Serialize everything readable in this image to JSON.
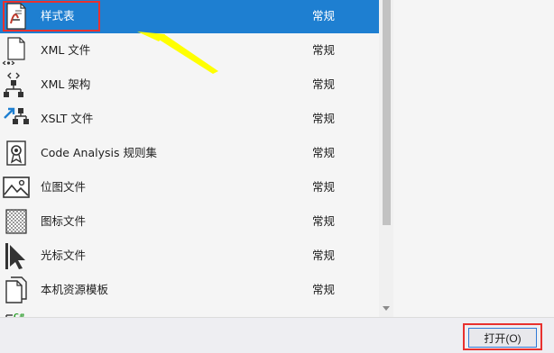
{
  "file_list": {
    "items": [
      {
        "name": "样式表",
        "type": "常规",
        "icon": "stylesheet-icon",
        "selected": true
      },
      {
        "name": "XML 文件",
        "type": "常规",
        "icon": "xml-file-icon"
      },
      {
        "name": "XML 架构",
        "type": "常规",
        "icon": "xml-schema-icon"
      },
      {
        "name": "XSLT 文件",
        "type": "常规",
        "icon": "xslt-file-icon"
      },
      {
        "name": "Code Analysis 规则集",
        "type": "常规",
        "icon": "ruleset-icon"
      },
      {
        "name": "位图文件",
        "type": "常规",
        "icon": "bitmap-icon"
      },
      {
        "name": "图标文件",
        "type": "常规",
        "icon": "icon-file-icon"
      },
      {
        "name": "光标文件",
        "type": "常规",
        "icon": "cursor-file-icon"
      },
      {
        "name": "本机资源模板",
        "type": "常规",
        "icon": "resource-template-icon"
      },
      {
        "name": "",
        "type": "",
        "icon": "csharp-file-icon"
      }
    ]
  },
  "footer": {
    "open_button_label": "打开(O)"
  },
  "colors": {
    "selection": "#1e7fd1",
    "highlight_box": "#e8312f",
    "annotation_arrow": "#ffff00"
  }
}
